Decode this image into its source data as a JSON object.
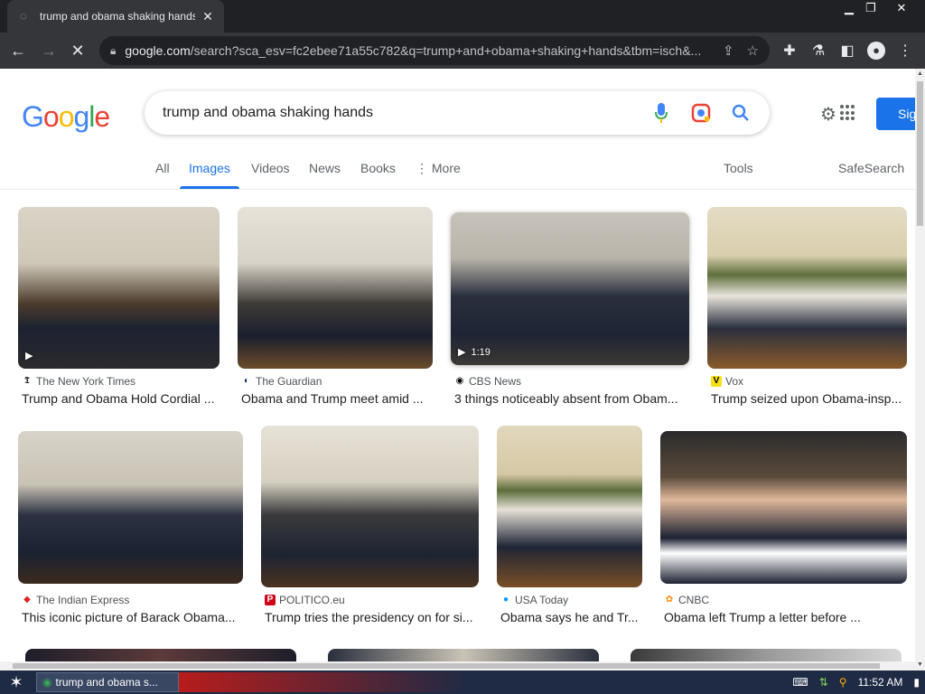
{
  "browser": {
    "tab_title": "trump and obama shaking hands - G",
    "url_domain": "google.com",
    "url_path": "/search?sca_esv=fc2ebee71a55c782&q=trump+and+obama+shaking+hands&tbm=isch&..."
  },
  "search": {
    "logo": "Google",
    "query": "trump and obama shaking hands",
    "signin_label": "Sig"
  },
  "tabs": {
    "all": "All",
    "images": "Images",
    "videos": "Videos",
    "news": "News",
    "books": "Books",
    "more": "More",
    "tools": "Tools",
    "safesearch": "SafeSearch"
  },
  "results": [
    {
      "source": "The New York Times",
      "caption": "Trump and Obama Hold Cordial ...",
      "icon_color": "#000000",
      "icon_glyph": "𝕿"
    },
    {
      "source": "The Guardian",
      "caption": "Obama and Trump meet amid ...",
      "icon_color": "#052962",
      "icon_glyph": "◐"
    },
    {
      "source": "CBS News",
      "caption": "3 things noticeably absent from Obam...",
      "icon_color": "#000000",
      "icon_glyph": "◉",
      "duration": "1:19"
    },
    {
      "source": "Vox",
      "caption": "Trump seized upon Obama-insp...",
      "icon_color": "#f7e214",
      "icon_glyph": "V"
    },
    {
      "source": "The Indian Express",
      "caption": "This iconic picture of Barack Obama...",
      "icon_color": "#e2231a",
      "icon_glyph": "◆"
    },
    {
      "source": "POLITICO.eu",
      "caption": "Trump tries the presidency on for si...",
      "icon_color": "#d0021b",
      "icon_glyph": "P"
    },
    {
      "source": "USA Today",
      "caption": "Obama says he and Tr...",
      "icon_color": "#009bff",
      "icon_glyph": "●"
    },
    {
      "source": "CNBC",
      "caption": "Obama left Trump a letter before ...",
      "icon_color": "#ff8c00",
      "icon_glyph": "✿"
    }
  ],
  "taskbar": {
    "task_label": "trump and obama s...",
    "time": "11:52 AM"
  }
}
